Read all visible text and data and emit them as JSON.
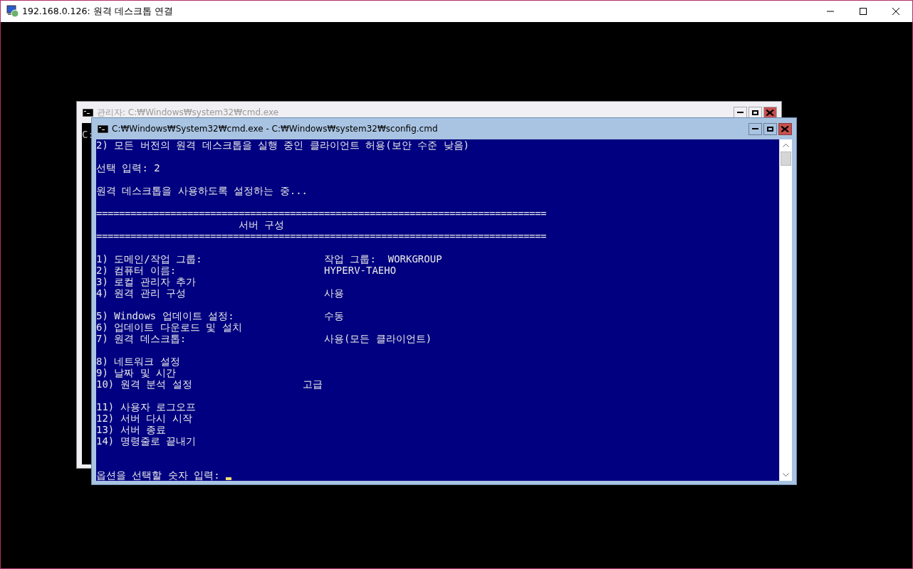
{
  "window": {
    "title": "192.168.0.126: 원격 데스크톱 연결"
  },
  "background_window": {
    "title": "관리자: C:₩Windows₩system32₩cmd.exe",
    "active": false,
    "console_text": "C:"
  },
  "foreground_window": {
    "title": "C:₩Windows₩System32₩cmd.exe - C:₩Windows₩system32₩sconfig.cmd",
    "active": true,
    "lines": [
      {
        "kind": "text",
        "text": "2) 모든 버전의 원격 데스크톱을 실행 중인 클라이언트 허용(보안 수준 낮음)"
      },
      {
        "kind": "blank"
      },
      {
        "kind": "text",
        "text": "선택 입력: 2"
      },
      {
        "kind": "blank"
      },
      {
        "kind": "text",
        "text": "원격 데스크톱을 사용하도록 설정하는 중..."
      },
      {
        "kind": "blank"
      },
      {
        "kind": "rule",
        "text": "==============================================================================="
      },
      {
        "kind": "heading",
        "text": "서버 구성"
      },
      {
        "kind": "rule",
        "text": "==============================================================================="
      },
      {
        "kind": "blank"
      },
      {
        "kind": "item",
        "label": "1) 도메인/작업 그룹:",
        "value": "작업 그룹:  WORKGROUP"
      },
      {
        "kind": "item",
        "label": "2) 컴퓨터 이름:",
        "value": "HYPERV-TAEHO"
      },
      {
        "kind": "text",
        "text": "3) 로컬 관리자 추가"
      },
      {
        "kind": "item",
        "label": "4) 원격 관리 구성",
        "value": "사용"
      },
      {
        "kind": "blank"
      },
      {
        "kind": "item",
        "label": "5) Windows 업데이트 설정:",
        "value": "수동"
      },
      {
        "kind": "text",
        "text": "6) 업데이트 다운로드 및 설치"
      },
      {
        "kind": "item",
        "label": "7) 원격 데스크톱:",
        "value": "사용(모든 클라이언트)"
      },
      {
        "kind": "blank"
      },
      {
        "kind": "text",
        "text": "8) 네트워크 설정"
      },
      {
        "kind": "text",
        "text": "9) 날짜 및 시간"
      },
      {
        "kind": "item_short",
        "label": "10) 원격 분석 설정",
        "value": "고급"
      },
      {
        "kind": "blank"
      },
      {
        "kind": "text",
        "text": "11) 사용자 로그오프"
      },
      {
        "kind": "text",
        "text": "12) 서버 다시 시작"
      },
      {
        "kind": "text",
        "text": "13) 서버 종료"
      },
      {
        "kind": "text",
        "text": "14) 명령줄로 끝내기"
      },
      {
        "kind": "blank"
      },
      {
        "kind": "blank"
      },
      {
        "kind": "prompt",
        "text": "옵션을 선택할 숫자 입력:"
      }
    ]
  }
}
